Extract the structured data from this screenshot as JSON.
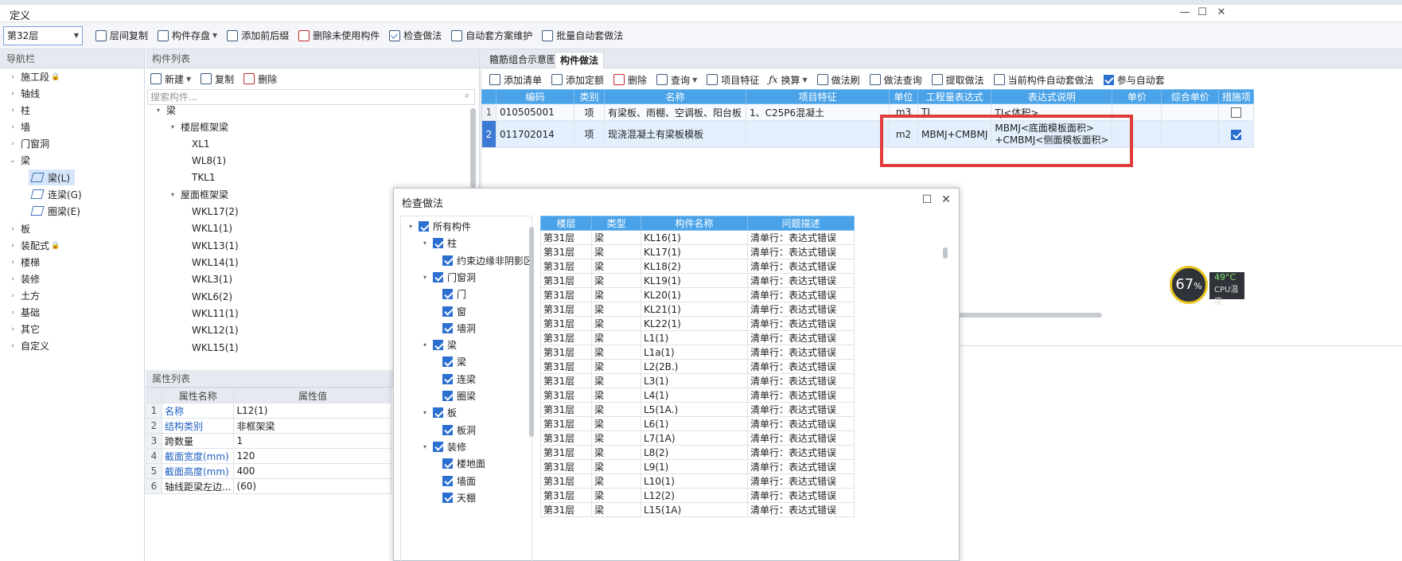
{
  "window": {
    "title": "定义"
  },
  "toolbar": {
    "floor": "第32层",
    "buttons": [
      "层间复制",
      "构件存盘",
      "添加前后缀",
      "删除未使用构件",
      "检查做法",
      "自动套方案维护",
      "批量自动套做法"
    ]
  },
  "nav": {
    "title": "导航栏",
    "items": [
      "施工段",
      "轴线",
      "柱",
      "墙",
      "门窗洞",
      "梁",
      "板",
      "装配式",
      "楼梯",
      "装修",
      "土方",
      "基础",
      "其它",
      "自定义"
    ],
    "beam_children": [
      "梁(L)",
      "连梁(G)",
      "圈梁(E)"
    ]
  },
  "complist": {
    "title": "构件列表",
    "buttons": [
      "新建",
      "复制",
      "删除"
    ],
    "search_placeholder": "搜索构件...",
    "root": "梁",
    "groups": [
      {
        "name": "楼层框架梁",
        "items": [
          "XL1",
          "WL8(1)",
          "TKL1"
        ]
      },
      {
        "name": "屋面框架梁",
        "items": [
          "WKL17(2)",
          "WKL1(1)",
          "WKL13(1)",
          "WKL14(1)",
          "WKL3(1)",
          "WKL6(2)",
          "WKL11(1)",
          "WKL12(1)",
          "WKL15(1)"
        ]
      }
    ]
  },
  "props": {
    "title": "属性列表",
    "headers": [
      "属性名称",
      "属性值"
    ],
    "rows": [
      {
        "idx": "1",
        "name": "名称",
        "value": "L12(1)",
        "blue": true
      },
      {
        "idx": "2",
        "name": "结构类别",
        "value": "非框架梁",
        "blue": true
      },
      {
        "idx": "3",
        "name": "跨数量",
        "value": "1",
        "blue": false
      },
      {
        "idx": "4",
        "name": "截面宽度(mm)",
        "value": "120",
        "blue": true
      },
      {
        "idx": "5",
        "name": "截面高度(mm)",
        "value": "400",
        "blue": true
      },
      {
        "idx": "6",
        "name": "轴线距梁左边...",
        "value": "(60)",
        "blue": false
      }
    ]
  },
  "method": {
    "tabs": [
      "箍筋组合示意图",
      "构件做法"
    ],
    "toolbar": [
      "添加清单",
      "添加定额",
      "删除",
      "查询",
      "项目特征",
      "换算",
      "做法刷",
      "做法查询",
      "提取做法",
      "当前构件自动套做法",
      "参与自动套"
    ],
    "headers": [
      "编码",
      "类别",
      "名称",
      "项目特征",
      "单位",
      "工程量表达式",
      "表达式说明",
      "单价",
      "综合单价",
      "措施项"
    ],
    "rows": [
      {
        "idx": "1",
        "code": "010505001",
        "type": "项",
        "name": "有梁板、雨棚、空调板、阳台板",
        "feature": "1、C25P6混凝土",
        "unit": "m3",
        "expr": "TJ",
        "desc1": "TJ<体积>",
        "desc2": "",
        "checked": false
      },
      {
        "idx": "2",
        "code": "011702014",
        "type": "项",
        "name": "现浇混凝土有梁板模板",
        "feature": "",
        "unit": "m2",
        "expr": "MBMJ+CMBMJ",
        "desc1": "MBMJ<底面模板面积>",
        "desc2": "+CMBMJ<侧面模板面积>",
        "checked": true
      }
    ]
  },
  "dialog": {
    "title": "检查做法",
    "tree": [
      {
        "label": "所有构件",
        "level": 0,
        "arrow": true
      },
      {
        "label": "柱",
        "level": 1,
        "arrow": true
      },
      {
        "label": "约束边缘非阴影区",
        "level": 2,
        "arrow": false
      },
      {
        "label": "门窗洞",
        "level": 1,
        "arrow": true
      },
      {
        "label": "门",
        "level": 2,
        "arrow": false
      },
      {
        "label": "窗",
        "level": 2,
        "arrow": false
      },
      {
        "label": "墙洞",
        "level": 2,
        "arrow": false
      },
      {
        "label": "梁",
        "level": 1,
        "arrow": true
      },
      {
        "label": "梁",
        "level": 2,
        "arrow": false
      },
      {
        "label": "连梁",
        "level": 2,
        "arrow": false
      },
      {
        "label": "圈梁",
        "level": 2,
        "arrow": false
      },
      {
        "label": "板",
        "level": 1,
        "arrow": true
      },
      {
        "label": "板洞",
        "level": 2,
        "arrow": false
      },
      {
        "label": "装修",
        "level": 1,
        "arrow": true
      },
      {
        "label": "楼地面",
        "level": 2,
        "arrow": false
      },
      {
        "label": "墙面",
        "level": 2,
        "arrow": false
      },
      {
        "label": "天棚",
        "level": 2,
        "arrow": false
      }
    ],
    "headers": [
      "楼层",
      "类型",
      "构件名称",
      "问题描述"
    ],
    "floor": "第31层",
    "type": "梁",
    "issue": "清单行：表达式错误",
    "components": [
      "KL16(1)",
      "KL17(1)",
      "KL18(2)",
      "KL19(1)",
      "KL20(1)",
      "KL21(1)",
      "KL22(1)",
      "L1(1)",
      "L1a(1)",
      "L2(2B.)",
      "L3(1)",
      "L4(1)",
      "L5(1A.)",
      "L6(1)",
      "L7(1A)",
      "L8(2)",
      "L9(1)",
      "L10(1)",
      "L12(2)",
      "L15(1A)"
    ]
  },
  "cpu": {
    "usage": "67",
    "usage_unit": "%",
    "temp": "49°C",
    "label": "CPU温度"
  }
}
